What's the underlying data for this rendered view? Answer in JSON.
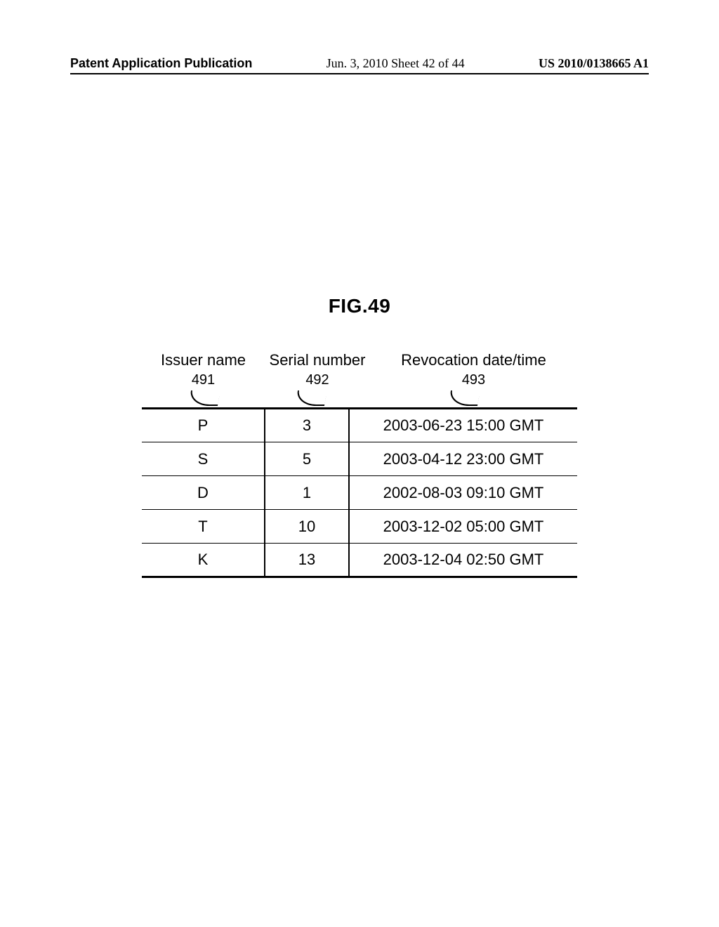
{
  "header": {
    "left": "Patent Application Publication",
    "center": "Jun. 3, 2010  Sheet 42 of 44",
    "right": "US 2010/0138665 A1"
  },
  "figure": {
    "title": "FIG.49",
    "columns": {
      "issuer_label": "Issuer name",
      "serial_label": "Serial number",
      "revocation_label": "Revocation date/time"
    },
    "refs": {
      "issuer": "491",
      "serial": "492",
      "revocation": "493"
    },
    "rows": [
      {
        "issuer": "P",
        "serial": "3",
        "revocation": "2003-06-23 15:00 GMT"
      },
      {
        "issuer": "S",
        "serial": "5",
        "revocation": "2003-04-12 23:00 GMT"
      },
      {
        "issuer": "D",
        "serial": "1",
        "revocation": "2002-08-03 09:10 GMT"
      },
      {
        "issuer": "T",
        "serial": "10",
        "revocation": "2003-12-02 05:00 GMT"
      },
      {
        "issuer": "K",
        "serial": "13",
        "revocation": "2003-12-04 02:50 GMT"
      }
    ]
  }
}
